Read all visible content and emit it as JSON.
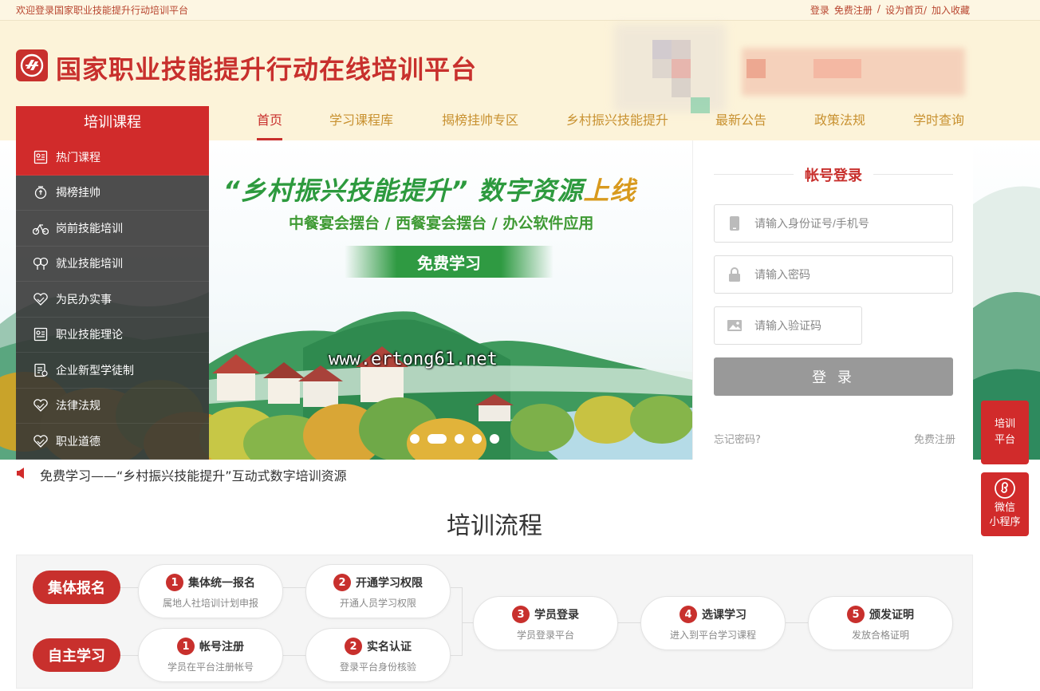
{
  "topbar": {
    "welcome": "欢迎登录国家职业技能提升行动培训平台",
    "login": "登录",
    "register": "免费注册",
    "sep": "/",
    "homepage": "设为首页/",
    "favorite": "加入收藏"
  },
  "header": {
    "title": "国家职业技能提升行动在线培训平台"
  },
  "nav": {
    "items": [
      "首页",
      "学习课程库",
      "揭榜挂帅专区",
      "乡村振兴技能提升",
      "最新公告",
      "政策法规",
      "学时查询"
    ],
    "active_index": 0
  },
  "sidebar": {
    "title": "培训课程",
    "items": [
      {
        "label": "热门课程",
        "icon": "course-icon"
      },
      {
        "label": "揭榜挂帅",
        "icon": "medal-icon"
      },
      {
        "label": "岗前技能培训",
        "icon": "bike-icon"
      },
      {
        "label": "就业技能培训",
        "icon": "tree-icon"
      },
      {
        "label": "为民办实事",
        "icon": "heart-icon"
      },
      {
        "label": "职业技能理论",
        "icon": "course-icon"
      },
      {
        "label": "企业新型学徒制",
        "icon": "document-icon"
      },
      {
        "label": "法律法规",
        "icon": "heart-icon"
      },
      {
        "label": "职业道德",
        "icon": "heart-icon"
      }
    ],
    "active_index": 0
  },
  "hero": {
    "title_part1": "“乡村振兴技能提升”",
    "title_part2": "数字资源",
    "title_part3": "上线",
    "subtitle": "中餐宴会摆台 / 西餐宴会摆台 / 办公软件应用",
    "button": "免费学习",
    "watermark": "www.ertong61.net",
    "slide_count": 5,
    "active_slide": 1
  },
  "login": {
    "title": "帐号登录",
    "username_placeholder": "请输入身份证号/手机号",
    "password_placeholder": "请输入密码",
    "captcha_placeholder": "请输入验证码",
    "button": "登 录",
    "forgot": "忘记密码?",
    "register": "免费注册"
  },
  "float": {
    "platform_line1": "培训",
    "platform_line2": "平台",
    "mini_line1": "微信",
    "mini_line2": "小程序"
  },
  "notice": {
    "text": "免费学习——“乡村振兴技能提升”互动式数字培训资源"
  },
  "process": {
    "title": "培训流程",
    "group_tag": "集体报名",
    "self_tag": "自主学习",
    "group_steps": [
      {
        "num": "1",
        "title": "集体统一报名",
        "desc": "属地人社培训计划申报"
      },
      {
        "num": "2",
        "title": "开通学习权限",
        "desc": "开通人员学习权限"
      }
    ],
    "self_steps": [
      {
        "num": "1",
        "title": "帐号注册",
        "desc": "学员在平台注册帐号"
      },
      {
        "num": "2",
        "title": "实名认证",
        "desc": "登录平台身份核验"
      }
    ],
    "shared_steps": [
      {
        "num": "3",
        "title": "学员登录",
        "desc": "学员登录平台"
      },
      {
        "num": "4",
        "title": "选课学习",
        "desc": "进入到平台学习课程"
      },
      {
        "num": "5",
        "title": "颁发证明",
        "desc": "发放合格证明"
      }
    ]
  },
  "colors": {
    "brand_red": "#c8302d",
    "nav_gold": "#c89130",
    "hero_green": "#2d9a3e",
    "header_bg": "#fcf3d9"
  }
}
